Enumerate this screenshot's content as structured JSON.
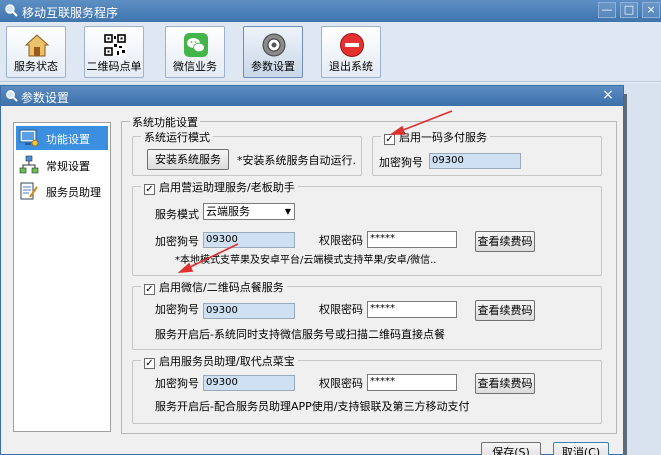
{
  "main_window": {
    "title": "移动互联服务程序",
    "controls": {
      "minimize": "—",
      "maximize": "□",
      "close": "×"
    }
  },
  "toolbar": {
    "items": [
      {
        "label": "服务状态",
        "icon": "house-icon"
      },
      {
        "label": "二维码点单",
        "icon": "qr-code-icon"
      },
      {
        "label": "微信业务",
        "icon": "wechat-icon"
      },
      {
        "label": "参数设置",
        "icon": "settings-icon"
      },
      {
        "label": "退出系统",
        "icon": "exit-icon"
      }
    ]
  },
  "dialog": {
    "title": "参数设置",
    "close": "×",
    "nav": [
      {
        "label": "功能设置",
        "selected": true
      },
      {
        "label": "常规设置",
        "selected": false
      },
      {
        "label": "服务员助理",
        "selected": false
      }
    ],
    "panel_title": "系统功能设置",
    "run_mode": {
      "title": "系统运行模式",
      "install_button": "安装系统服务",
      "hint": "*安装系统服务自动运行."
    },
    "one_code": {
      "title": "启用一码多付服务",
      "checked": true,
      "dog_label": "加密狗号",
      "dog_value": "09300"
    },
    "boss": {
      "title": "启用营运助理服务/老板助手",
      "checked": true,
      "mode_label": "服务模式",
      "mode_value": "云端服务",
      "dog_label": "加密狗号",
      "dog_value": "09300",
      "pwd_label": "权限密码",
      "pwd_value": "*****",
      "renew_button": "查看续费码",
      "note": "*本地模式支苹果及安卓平台/云端模式支持苹果/安卓/微信.."
    },
    "wechat": {
      "title": "启用微信/二维码点餐服务",
      "checked": true,
      "dog_label": "加密狗号",
      "dog_value": "09300",
      "pwd_label": "权限密码",
      "pwd_value": "*****",
      "renew_button": "查看续费码",
      "note": "服务开启后-系统同时支持微信服务号或扫描二维码直接点餐"
    },
    "waiter": {
      "title": "启用服务员助理/取代点菜宝",
      "checked": true,
      "dog_label": "加密狗号",
      "dog_value": "09300",
      "pwd_label": "权限密码",
      "pwd_value": "*****",
      "renew_button": "查看续费码",
      "note": "服务开启后-配合服务员助理APP使用/支持银联及第三方移动支付"
    },
    "save_button": "保存(S)",
    "cancel_button": "取消(C)"
  },
  "colors": {
    "title_bar": "#3f74ad",
    "nav_selected": "#3b8fe0",
    "annotation_arrow": "#e03030"
  }
}
